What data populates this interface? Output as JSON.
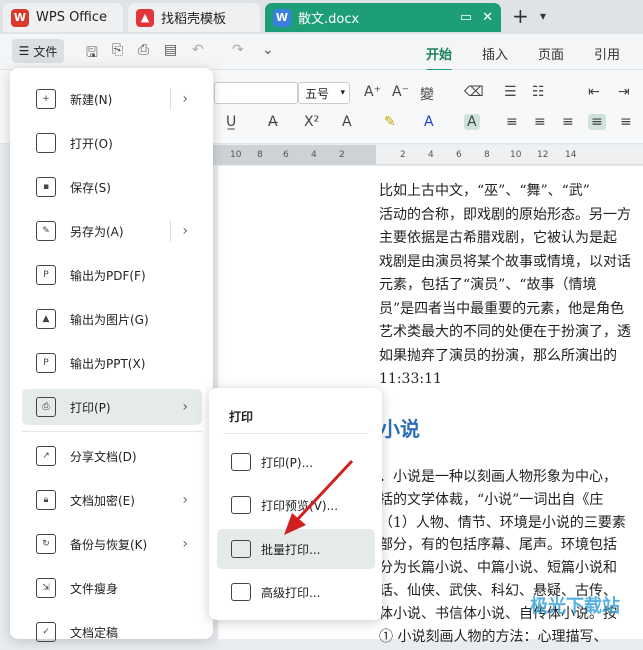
{
  "tabs": [
    {
      "label": "WPS Office"
    },
    {
      "label": "找稻壳模板"
    },
    {
      "label": "散文.docx"
    }
  ],
  "toolbar": {
    "file_label": "文件",
    "ribbon_tabs": [
      "开始",
      "插入",
      "页面",
      "引用"
    ],
    "active_tab": "开始"
  },
  "ribbon": {
    "font_size": "五号"
  },
  "ruler": {
    "numbers": [
      "10",
      "8",
      "6",
      "4",
      "2",
      "2",
      "4",
      "6",
      "8",
      "10",
      "12",
      "14"
    ]
  },
  "menu": {
    "items": [
      {
        "label": "新建(N)"
      },
      {
        "label": "打开(O)"
      },
      {
        "label": "保存(S)"
      },
      {
        "label": "另存为(A)"
      },
      {
        "label": "输出为PDF(F)"
      },
      {
        "label": "输出为图片(G)"
      },
      {
        "label": "输出为PPT(X)"
      },
      {
        "label": "打印(P)"
      },
      {
        "label": "分享文档(D)"
      },
      {
        "label": "文档加密(E)"
      },
      {
        "label": "备份与恢复(K)"
      },
      {
        "label": "文件瘦身"
      },
      {
        "label": "文档定稿"
      }
    ]
  },
  "submenu": {
    "title": "打印",
    "items": [
      {
        "label": "打印(P)..."
      },
      {
        "label": "打印预览(V)..."
      },
      {
        "label": "批量打印..."
      },
      {
        "label": "高级打印..."
      }
    ]
  },
  "document": {
    "lines": [
      "比如上古中文，“巫”、“舞”、“武”",
      "活动的合称，即戏剧的原始形态。另一方",
      "主要依据是古希腊戏剧，它被认为是起",
      "戏剧是由演员将某个故事或情境，以对话",
      "元素，包括了“演员”、“故事（情境",
      "员”是四者当中最重要的元素，他是角色",
      "艺术类最大的不同的处便在于扮演了，透",
      "如果抛弃了演员的扮演，那么所演出的"
    ],
    "time": "11:33:11",
    "heading": "小说",
    "lines2": [
      "．小说是一种以刻画人物形象为中心，",
      "括的文学体裁，“小说”一词出自《庄",
      "（1）人物、情节、环境是小说的三要素",
      "部分，有的包括序幕、尾声。环境包括",
      "分为长篇小说、中篇小说、短篇小说和",
      "话、仙侠、武侠、科幻、悬疑、古传、",
      "体小说、书信体小说、自传体小说。按",
      "① 小说刻画人物的方法：心理描写、"
    ]
  },
  "watermark": "极光下载站"
}
